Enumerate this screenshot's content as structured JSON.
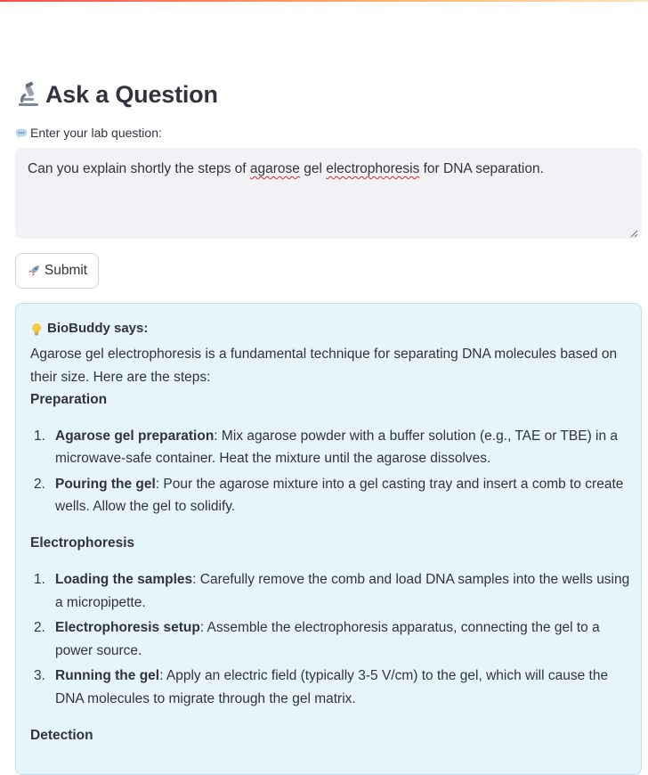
{
  "header": {
    "accent_gradient": [
      "#ff4b4b",
      "#ffb36b"
    ]
  },
  "page": {
    "title": "Ask a Question",
    "title_icon": "microscope-icon"
  },
  "question": {
    "label": "Enter your lab question:",
    "label_icon": "speech-bubble-icon",
    "value_parts": [
      "Can you explain shortly the steps of ",
      "agarose",
      " gel ",
      "electrophoresis",
      " for DNA separation."
    ]
  },
  "submit": {
    "label": "Submit",
    "icon": "rocket-icon"
  },
  "answer": {
    "header_icon": "lightbulb-icon",
    "header": "BioBuddy says:",
    "intro": "Agarose gel electrophoresis is a fundamental technique for separating DNA molecules based on their size. Here are the steps:",
    "sections": [
      {
        "title": "Preparation",
        "items": [
          {
            "num": "1.",
            "term": "Agarose gel preparation",
            "text": ": Mix agarose powder with a buffer solution (e.g., TAE or TBE) in a microwave-safe container. Heat the mixture until the agarose dissolves."
          },
          {
            "num": "2.",
            "term": "Pouring the gel",
            "text": ": Pour the agarose mixture into a gel casting tray and insert a comb to create wells. Allow the gel to solidify."
          }
        ]
      },
      {
        "title": "Electrophoresis",
        "items": [
          {
            "num": "1.",
            "term": "Loading the samples",
            "text": ": Carefully remove the comb and load DNA samples into the wells using a micropipette."
          },
          {
            "num": "2.",
            "term": "Electrophoresis setup",
            "text": ": Assemble the electrophoresis apparatus, connecting the gel to a power source."
          },
          {
            "num": "3.",
            "term": "Running the gel",
            "text": ": Apply an electric field (typically 3-5 V/cm) to the gel, which will cause the DNA molecules to migrate through the gel matrix."
          }
        ]
      },
      {
        "title": "Detection",
        "items": []
      }
    ]
  }
}
